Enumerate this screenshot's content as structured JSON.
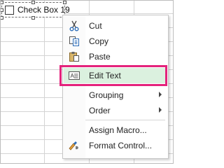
{
  "checkbox": {
    "label": "Check Box 19",
    "checked": false
  },
  "context_menu": {
    "items": [
      {
        "label": "Cut",
        "icon": "scissors-icon"
      },
      {
        "label": "Copy",
        "icon": "copy-icon"
      },
      {
        "label": "Paste",
        "icon": "paste-icon"
      },
      {
        "label": "Edit Text",
        "icon": "edit-text-icon",
        "highlighted": true
      },
      {
        "label": "Grouping",
        "submenu": true
      },
      {
        "label": "Order",
        "submenu": true
      },
      {
        "label": "Assign Macro..."
      },
      {
        "label": "Format Control...",
        "icon": "format-control-icon"
      }
    ]
  },
  "colors": {
    "highlight_border": "#e4237c",
    "highlight_fill": "#dbf1df",
    "gridline": "#d4d4d4"
  }
}
